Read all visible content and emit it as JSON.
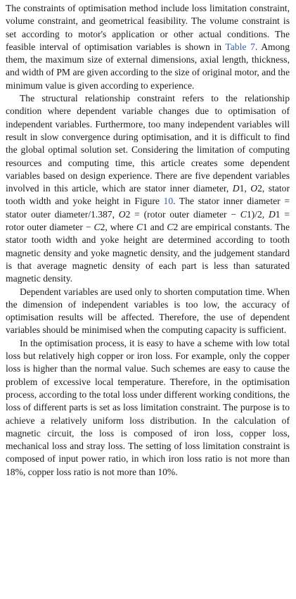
{
  "paragraphs": [
    {
      "indent": false,
      "parts": [
        {
          "t": "The constraints of optimisation method include loss limitation constraint, volume constraint, and geometrical feasibility. The volume constraint is set according to motor's application or other actual conditions. The feasible interval of optimisation variables is shown in "
        },
        {
          "t": "Table 7",
          "ref": true
        },
        {
          "t": ". Among them, the maximum size of external dimensions, axial length, thickness, and width of PM are given according to the size of original motor, and the minimum value is given according to experience."
        }
      ]
    },
    {
      "indent": true,
      "parts": [
        {
          "t": "The structural relationship constraint refers to the relationship condition where dependent variable changes due to optimisation of independent variables. Furthermore, too many independent variables will result in slow convergence during optimisation, and it is difficult to find the global optimal solution set. Considering the limitation of computing resources and computing time, this article creates some dependent variables based on design experience. There are five dependent variables involved in this article, which are stator inner diameter, "
        },
        {
          "t": "D",
          "sym": true
        },
        {
          "t": "1, "
        },
        {
          "t": "O",
          "sym": true
        },
        {
          "t": "2, stator tooth width and yoke height in Figure "
        },
        {
          "t": "10",
          "ref": true
        },
        {
          "t": ". The stator inner diameter = stator outer diameter/1.387, "
        },
        {
          "t": "O",
          "sym": true
        },
        {
          "t": "2 = (rotor outer diameter − "
        },
        {
          "t": "C",
          "sym": true
        },
        {
          "t": "1)/2, "
        },
        {
          "t": "D",
          "sym": true
        },
        {
          "t": "1 = rotor outer diameter − "
        },
        {
          "t": "C",
          "sym": true
        },
        {
          "t": "2, where "
        },
        {
          "t": "C",
          "sym": true
        },
        {
          "t": "1 and "
        },
        {
          "t": "C",
          "sym": true
        },
        {
          "t": "2 are empirical constants. The stator tooth width and yoke height are determined according to tooth magnetic density and yoke magnetic density, and the judgement standard is that average magnetic density of each part is less than saturated magnetic density."
        }
      ]
    },
    {
      "indent": true,
      "parts": [
        {
          "t": "Dependent variables are used only to shorten computation time. When the dimension of independent variables is too low, the accuracy of optimisation results will be affected. Therefore, the use of dependent variables should be minimised when the computing capacity is sufficient."
        }
      ]
    },
    {
      "indent": true,
      "parts": [
        {
          "t": "In the optimisation process, it is easy to have a scheme with low total loss but relatively high copper or iron loss. For example, only the copper loss is higher than the normal value. Such schemes are easy to cause the problem of excessive local temperature. Therefore, in the optimisation process, according to the total loss under different working conditions, the loss of different parts is set as loss limitation constraint. The purpose is to achieve a relatively uniform loss distribution. In the calculation of magnetic circuit, the loss is composed of iron loss, copper loss, mechanical loss and stray loss. The setting of loss limitation constraint is composed of input power ratio, in which iron loss ratio is not more than 18%, copper loss ratio is not more than 10%."
        }
      ]
    }
  ],
  "colors": {
    "text": "#1a1a1a",
    "link": "#2f5fa8",
    "background": "#ffffff"
  }
}
